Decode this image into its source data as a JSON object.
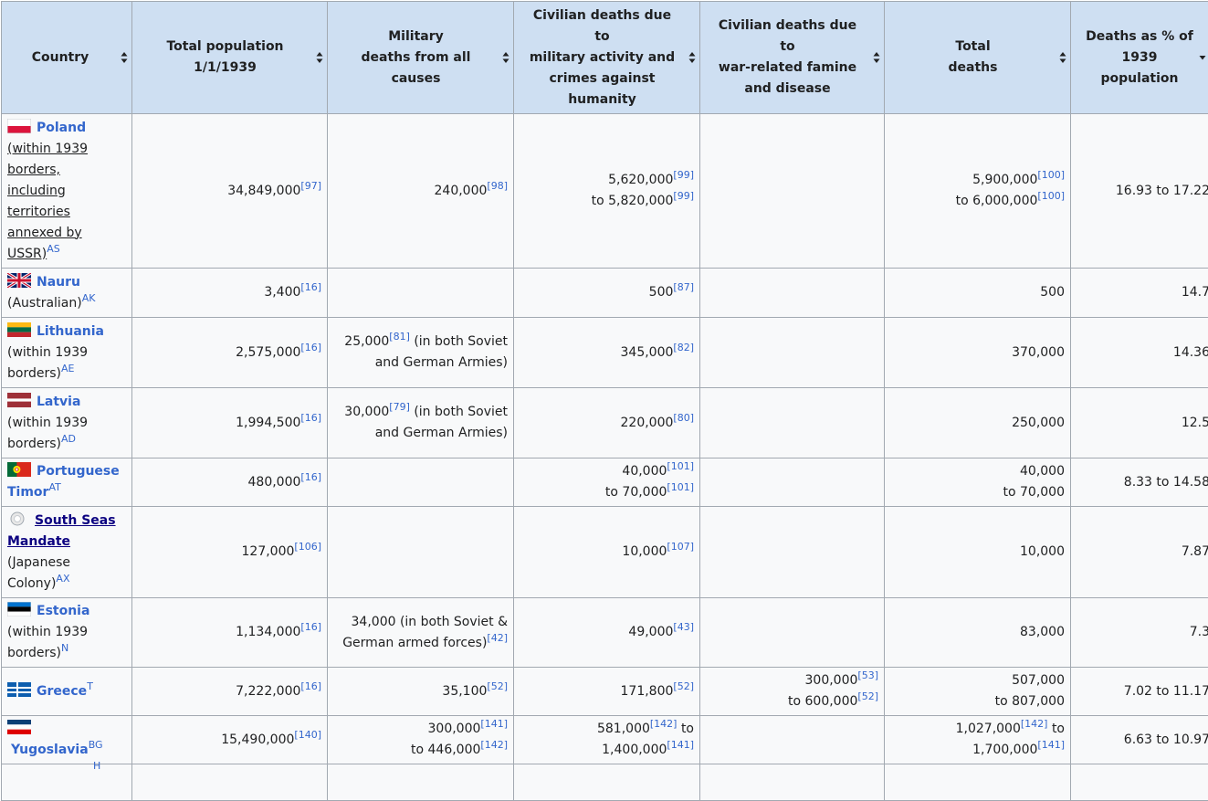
{
  "headers": [
    {
      "l1": "Country"
    },
    {
      "l1": "Total population",
      "l2": "1/1/1939"
    },
    {
      "l1": "Military",
      "l2": "deaths from all",
      "l3": "causes"
    },
    {
      "l1": "Civilian deaths due",
      "l2": "to",
      "l3": "military activity and",
      "l4": "crimes against",
      "l5": "humanity"
    },
    {
      "l1": "Civilian deaths due",
      "l2": "to",
      "l3": "war-related famine",
      "l4": "and disease"
    },
    {
      "l1": "Total",
      "l2": "deaths"
    },
    {
      "l1": "Deaths as % of",
      "l2": "1939",
      "l3": "population"
    }
  ],
  "rows": [
    {
      "name": "Poland",
      "country_lines": [
        "(within 1939",
        "borders,",
        "including",
        "territories",
        "annexed by",
        "USSR)"
      ],
      "note": "AS",
      "pop": "34,849,000",
      "pop_ref": "[97]",
      "mil": "240,000",
      "mil_ref": "[98]",
      "civ_a": "5,620,000",
      "civ_a_ref": "[99]",
      "civ_b": "to 5,820,000",
      "civ_b_ref": "[99]",
      "tot_a": "5,900,000",
      "tot_a_ref": "[100]",
      "tot_b": "to 6,000,000",
      "tot_b_ref": "[100]",
      "pct": "16.93 to 17.22"
    },
    {
      "name": "Nauru",
      "country_suffix": "(Australian)",
      "note": "AK",
      "pop": "3,400",
      "pop_ref": "[16]",
      "civ": "500",
      "civ_ref": "[87]",
      "tot": "500",
      "pct": "14.7"
    },
    {
      "name": "Lithuania",
      "country_lines": [
        "(within 1939",
        "borders)"
      ],
      "note": "AE",
      "pop": "2,575,000",
      "pop_ref": "[16]",
      "mil": "25,000",
      "mil_ref": "[81]",
      "mil_tail_a": "(in both Soviet",
      "mil_tail_b": "and German Armies)",
      "civ": "345,000",
      "civ_ref": "[82]",
      "tot": "370,000",
      "pct": "14.36"
    },
    {
      "name": "Latvia",
      "country_lines": [
        "(within 1939",
        "borders)"
      ],
      "note": "AD",
      "pop": "1,994,500",
      "pop_ref": "[16]",
      "mil": "30,000",
      "mil_ref": "[79]",
      "mil_tail_a": "(in both Soviet",
      "mil_tail_b": "and German Armies)",
      "civ": "220,000",
      "civ_ref": "[80]",
      "tot": "250,000",
      "pct": "12.5"
    },
    {
      "name_a": "Portuguese",
      "name_b": "Timor",
      "note": "AT",
      "pop": "480,000",
      "pop_ref": "[16]",
      "civ_a": "40,000",
      "civ_a_ref": "[101]",
      "civ_b": "to 70,000",
      "civ_b_ref": "[101]",
      "tot_a": "40,000",
      "tot_b": "to 70,000",
      "pct": "8.33 to 14.58"
    },
    {
      "name_a": "South Seas",
      "name_b": "Mandate",
      "country_lines": [
        "(Japanese",
        "Colony)"
      ],
      "note": "AX",
      "pop": "127,000",
      "pop_ref": "[106]",
      "civ": "10,000",
      "civ_ref": "[107]",
      "tot": "10,000",
      "pct": "7.87"
    },
    {
      "name": "Estonia",
      "country_lines": [
        "(within 1939",
        "borders)"
      ],
      "note": "N",
      "pop": "1,134,000",
      "pop_ref": "[16]",
      "mil_a": "34,000 (in both Soviet &",
      "mil_b": "German armed forces)",
      "mil_ref": "[42]",
      "civ": "49,000",
      "civ_ref": "[43]",
      "tot": "83,000",
      "pct": "7.3"
    },
    {
      "name": "Greece",
      "note": "T",
      "pop": "7,222,000",
      "pop_ref": "[16]",
      "mil": "35,100",
      "mil_ref": "[52]",
      "civ": "171,800",
      "civ_ref": "[52]",
      "fam_a": "300,000",
      "fam_a_ref": "[53]",
      "fam_b": "to 600,000",
      "fam_b_ref": "[52]",
      "tot_a": "507,000",
      "tot_b": "to 807,000",
      "pct": "7.02 to 11.17"
    },
    {
      "name": "Yugoslavia",
      "note": "BG",
      "pop": "15,490,000",
      "pop_ref": "[140]",
      "mil_a": "300,000",
      "mil_a_ref": "[141]",
      "mil_b": "to 446,000",
      "mil_b_ref": "[142]",
      "civ_a": "581,000",
      "civ_a_ref": "[142]",
      "civ_a_tail": "to",
      "civ_b": "1,400,000",
      "civ_b_ref": "[141]",
      "tot_a": "1,027,000",
      "tot_a_ref": "[142]",
      "tot_a_tail": "to",
      "tot_b": "1,700,000",
      "tot_b_ref": "[141]",
      "pct": "6.63 to 10.97"
    },
    {
      "clip_note": "H"
    }
  ]
}
